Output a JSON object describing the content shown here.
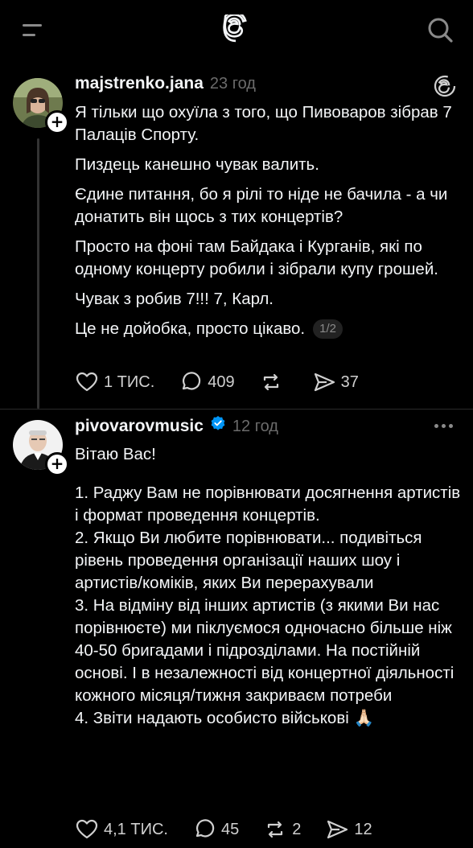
{
  "app": {
    "name": "Threads"
  },
  "icons": {
    "menu": "menu-icon",
    "logo": "threads-logo-icon",
    "search": "search-icon",
    "like": "heart-icon",
    "reply": "comment-icon",
    "repost": "repost-icon",
    "share": "share-icon",
    "more": "more-options-icon",
    "verified": "verified-badge-icon",
    "follow": "plus-icon"
  },
  "colors": {
    "background": "#000000",
    "text": "#f3f5f7",
    "muted": "#6b6b6b",
    "verified": "#0095f6"
  },
  "posts": [
    {
      "username": "majstrenko.jana",
      "time": "23 год",
      "verified": false,
      "paragraphs": [
        "Я тільки що охуїла з того, що Пивоваров зібрав 7 Палаців Спорту.",
        "Пиздець канешно чувак валить.",
        "Єдине питання, бо я рілі то ніде не бачила - а чи донатить він щось з тих концертів?",
        "Просто на фоні там Байдака і Курганів, які по одному концерту робили і зібрали купу грошей.",
        "Чувак з робив 7!!! 7, Карл.",
        "Це не дойобка, просто цікаво."
      ],
      "pager": "1/2",
      "likes": "1 ТИС.",
      "replies": "409",
      "reposts": "",
      "shares": "37"
    },
    {
      "username": "pivovarovmusic",
      "time": "12 год",
      "verified": true,
      "greeting": "Вітаю Вас!",
      "lines": [
        "1. Раджу Вам не порівнювати досягнення артистів і формат проведення концертів.",
        "2. Якщо Ви любите порівнювати... подивіться рівень проведення організації наших шоу і артистів/коміків, яких Ви перерахували",
        "3. На відміну від інших артистів (з якими Ви нас порівнюєте) ми піклуємося одночасно більше ніж 40-50 бригадами і підрозділами. На постійній основі. І в незалежності від концертної діяльності кожного місяця/тижня закриваєм потреби",
        "4. Звіти надають особисто військові 🙏🏻"
      ],
      "likes": "4,1 ТИС.",
      "replies": "45",
      "reposts": "2",
      "shares": "12"
    }
  ]
}
